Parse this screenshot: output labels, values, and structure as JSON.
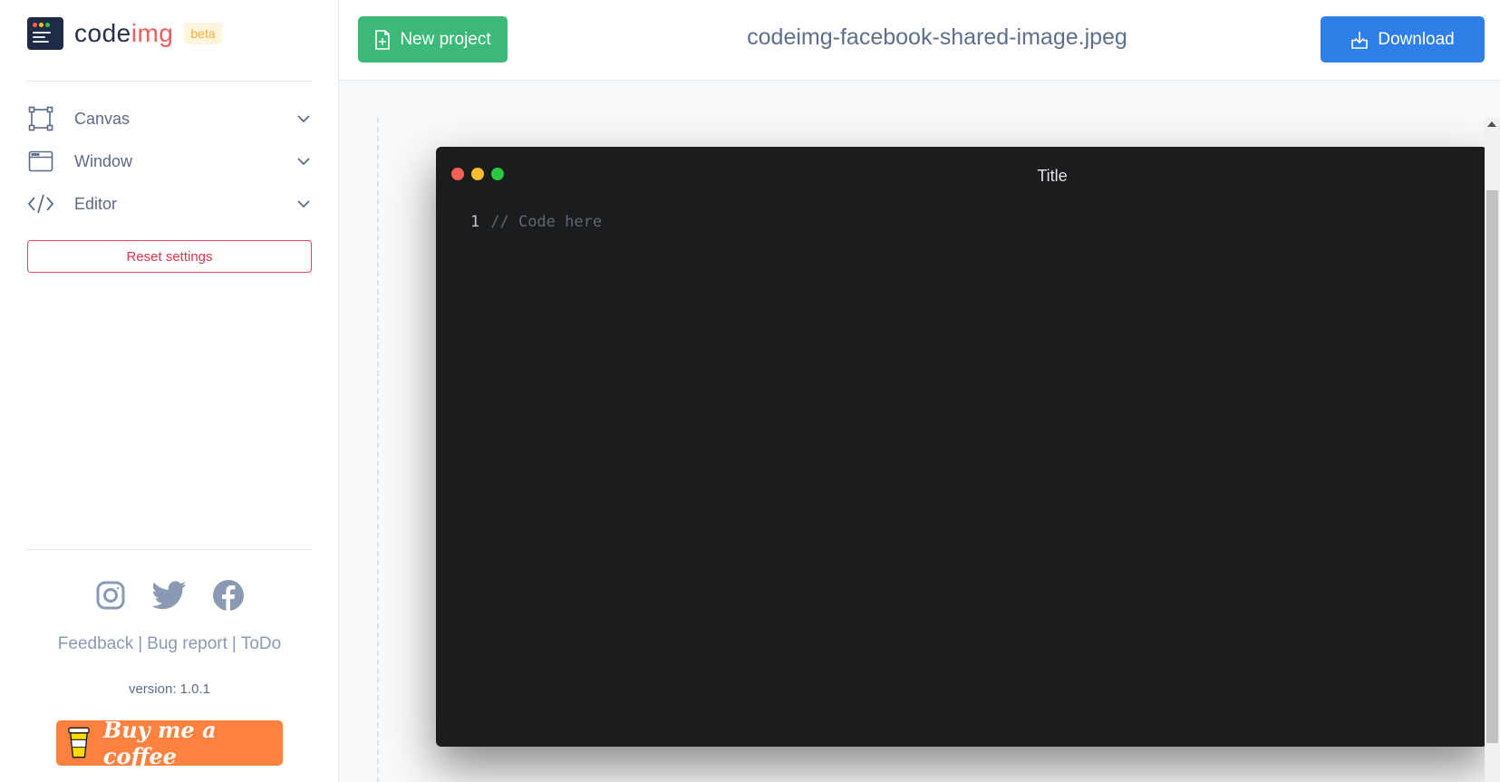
{
  "brand": {
    "name_part1": "code",
    "name_part2": "img",
    "badge": "beta"
  },
  "sidebar": {
    "items": [
      {
        "label": "Canvas",
        "icon": "canvas-frame-icon"
      },
      {
        "label": "Window",
        "icon": "window-icon"
      },
      {
        "label": "Editor",
        "icon": "code-icon"
      }
    ],
    "reset_label": "Reset settings",
    "social": [
      "instagram-icon",
      "twitter-icon",
      "facebook-icon"
    ],
    "links": {
      "feedback": "Feedback",
      "bug_report": "Bug report",
      "todo": "ToDo",
      "separator": "|"
    },
    "version": "version: 1.0.1",
    "coffee_label": "Buy me a coffee"
  },
  "toolbar": {
    "new_project_label": "New project",
    "filename": "codeimg-facebook-shared-image.jpeg",
    "download_label": "Download"
  },
  "editor": {
    "window_title": "Title",
    "lines": [
      {
        "number": "1",
        "code": "// Code here"
      }
    ]
  },
  "colors": {
    "new_project": "#3cb878",
    "download": "#2f7fe8",
    "reset": "#e0475d",
    "coffee": "#ff813f",
    "traffic_red": "#ff5f57",
    "traffic_yellow": "#febc2e",
    "traffic_green": "#28c840",
    "editor_bg": "#1b1c1e"
  }
}
